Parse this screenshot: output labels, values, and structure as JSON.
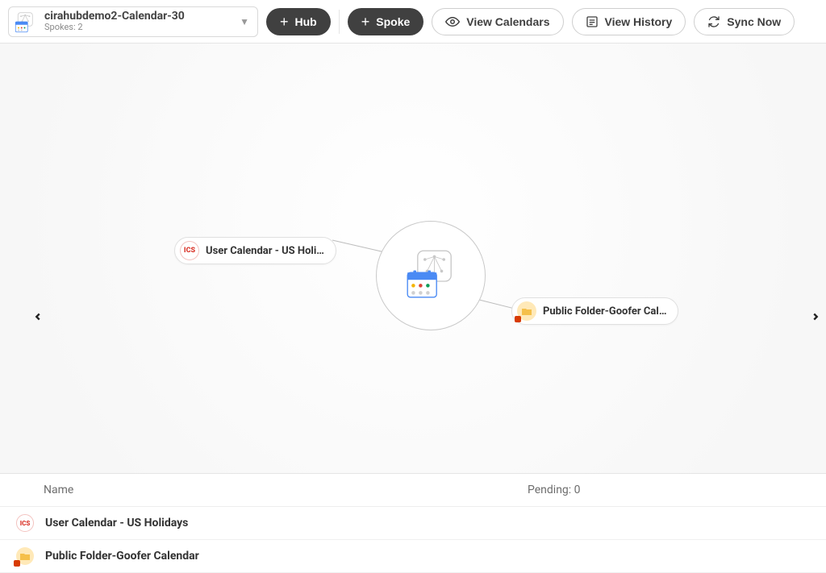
{
  "toolbar": {
    "hub_selector": {
      "title": "cirahubdemo2-Calendar-30",
      "subtitle": "Spokes: 2"
    },
    "hub_button": "Hub",
    "spoke_button": "Spoke",
    "view_calendars": "View Calendars",
    "view_history": "View History",
    "sync_now": "Sync Now"
  },
  "graph": {
    "spoke_left": "User Calendar - US Holi…",
    "spoke_right": "Public Folder-Goofer Cal…"
  },
  "table": {
    "header_name": "Name",
    "header_pending": "Pending: 0",
    "rows": [
      {
        "icon": "ics",
        "name": "User Calendar - US Holidays"
      },
      {
        "icon": "pf",
        "name": "Public Folder-Goofer Calendar"
      }
    ]
  }
}
